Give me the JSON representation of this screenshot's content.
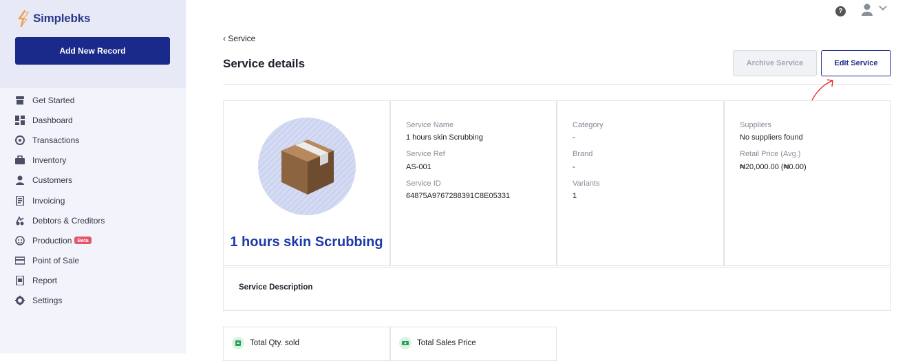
{
  "app": {
    "name": "Simplebks"
  },
  "sidebar": {
    "add_button": "Add New Record",
    "items": [
      {
        "label": "Get Started",
        "icon": "store-icon"
      },
      {
        "label": "Dashboard",
        "icon": "dashboard-icon"
      },
      {
        "label": "Transactions",
        "icon": "transactions-icon"
      },
      {
        "label": "Inventory",
        "icon": "briefcase-icon"
      },
      {
        "label": "Customers",
        "icon": "person-icon"
      },
      {
        "label": "Invoicing",
        "icon": "invoice-icon"
      },
      {
        "label": "Debtors & Creditors",
        "icon": "debtors-icon"
      },
      {
        "label": "Production",
        "icon": "production-icon",
        "badge": "Beta"
      },
      {
        "label": "Point of Sale",
        "icon": "card-icon"
      },
      {
        "label": "Report",
        "icon": "report-icon"
      },
      {
        "label": "Settings",
        "icon": "gear-icon"
      }
    ]
  },
  "header": {
    "help_label": "?"
  },
  "breadcrumb": {
    "label": "‹ Service"
  },
  "page": {
    "title": "Service details",
    "archive_button": "Archive Service",
    "edit_button": "Edit Service"
  },
  "service": {
    "title": "1 hours skin Scrubbing",
    "fields": {
      "service_name_label": "Service Name",
      "service_name": "1 hours skin Scrubbing",
      "service_ref_label": "Service Ref",
      "service_ref": "AS-001",
      "service_id_label": "Service ID",
      "service_id": "64875A9767288391C8E05331",
      "category_label": "Category",
      "category": "-",
      "brand_label": "Brand",
      "brand": "-",
      "variants_label": "Variants",
      "variants": "1",
      "suppliers_label": "Suppliers",
      "suppliers": "No suppliers found",
      "retail_price_label": "Retail Price (Avg.)",
      "retail_price": "₦20,000.00 (₦0.00)"
    },
    "description_title": "Service Description"
  },
  "stats": {
    "total_qty_label": "Total Qty. sold",
    "total_sales_label": "Total Sales Price"
  },
  "colors": {
    "brand": "#1a2a8a",
    "accent_title": "#1e3aa8",
    "beta_badge": "#e8556a",
    "annotation": "#e0201c"
  }
}
